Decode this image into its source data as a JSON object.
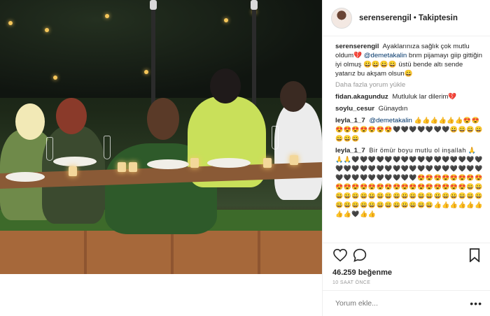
{
  "header": {
    "username": "serenserengil",
    "separator": "•",
    "follow_status": "Takiptesin"
  },
  "caption": {
    "username": "serenserengil",
    "text_1": "Ayaklarınıza sağlık çok mutlu oldum💔",
    "mention": "@demetakalin",
    "text_2": "bnm pijamayı giip gittiğin iyi olmuş 😀😀😀😀 üstü bende altı sende yatarız bu akşam olsun😀"
  },
  "load_more": "Daha fazla yorum yükle",
  "comments": [
    {
      "username": "fidan.akagunduz",
      "text": "Mutluluk lar dilerim💔"
    },
    {
      "username": "soylu_cesur",
      "text": "Günaydın"
    },
    {
      "username": "leyla_1_7",
      "mention": "@demetakalin",
      "text": "👍👍👍👍👍👍😍😍😍😍😍😍😍😍😍🖤🖤🖤🖤🖤🖤🖤😀😀😀😀😀😀😀"
    },
    {
      "username": "leyla_1_7",
      "text": "Bir ömür boyu mutlu ol inşallah 🙏🙏🙏🖤🖤🖤🖤🖤🖤🖤🖤🖤🖤🖤🖤🖤🖤🖤🖤🖤🖤🖤🖤🖤🖤🖤🖤🖤🖤🖤🖤🖤🖤🖤🖤🖤🖤🖤🖤🖤🖤🖤🖤🖤🖤🖤🖤😍😍😍😍😍😍😍😍😍😍😍😍😍😍😍😍😍😍😍😍😍😍😍😍😀😀😀😀😀😀😀😀😀😀😀😀😀😀😀😀😀😀😀😀😀😀😀😀😀😀😀😀😀😀😀😀👍👍👍👍👍👍👍👍🖤👍👍"
    }
  ],
  "actions": {
    "like_icon": "heart-icon",
    "comment_icon": "comment-icon",
    "save_icon": "bookmark-icon",
    "likes": "46.259 beğenme",
    "time": "10 SAAT ÖNCE"
  },
  "add_comment": {
    "placeholder": "Yorum ekle...",
    "more_icon": "more-options-icon"
  }
}
